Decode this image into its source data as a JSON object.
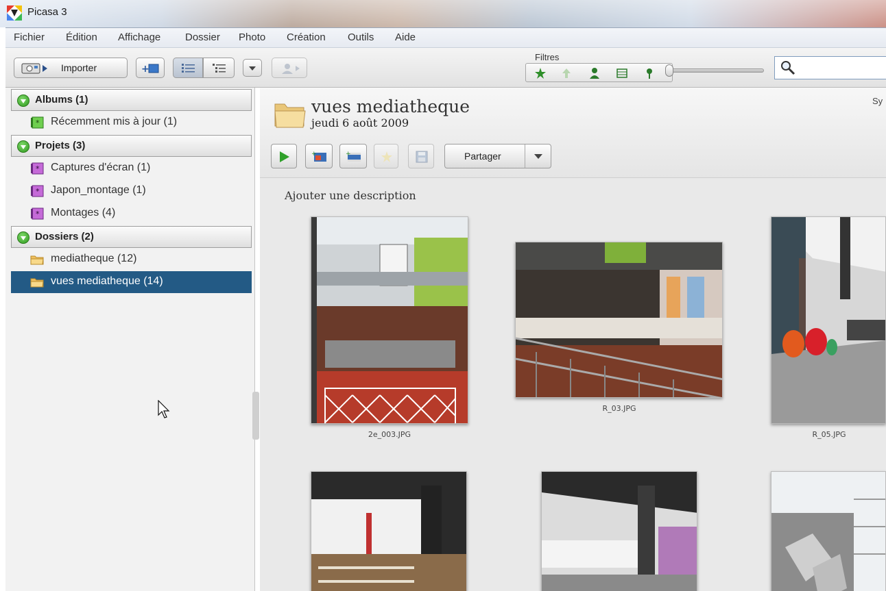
{
  "window": {
    "title": "Picasa 3"
  },
  "menu": [
    "Fichier",
    "Édition",
    "Affichage",
    "Dossier",
    "Photo",
    "Création",
    "Outils",
    "Aide"
  ],
  "toolbar": {
    "import_label": "Importer",
    "filters_label": "Filtres",
    "filter_icons": [
      "star-icon",
      "upload-icon",
      "person-icon",
      "film-icon",
      "map-pin-icon"
    ],
    "search_value": ""
  },
  "sidebar": {
    "albums": {
      "label": "Albums (1)",
      "items": [
        {
          "label": "Récemment mis à jour (1)",
          "icon": "album-icon"
        }
      ]
    },
    "projects": {
      "label": "Projets (3)",
      "items": [
        {
          "label": "Captures d'écran (1)",
          "icon": "project-icon"
        },
        {
          "label": "Japon_montage (1)",
          "icon": "project-icon"
        },
        {
          "label": "Montages (4)",
          "icon": "project-icon"
        }
      ]
    },
    "folders": {
      "label": "Dossiers (2)",
      "items": [
        {
          "label": "mediatheque (12)",
          "icon": "folder-icon"
        },
        {
          "label": "vues mediatheque (14)",
          "icon": "folder-icon",
          "selected": true
        }
      ]
    }
  },
  "folder_view": {
    "title": "vues mediatheque",
    "date": "jeudi 6 août 2009",
    "sync_label": "Sy",
    "share_label": "Partager",
    "description_placeholder": "Ajouter une description",
    "photos": [
      {
        "caption": "2e_003.JPG"
      },
      {
        "caption": "R_03.JPG"
      },
      {
        "caption": "R_05.JPG"
      },
      {
        "caption": ""
      },
      {
        "caption": ""
      },
      {
        "caption": ""
      }
    ]
  },
  "colors": {
    "selection": "#235a85",
    "accent_green": "#2e9a1e",
    "search_border": "#7f9cbd"
  }
}
